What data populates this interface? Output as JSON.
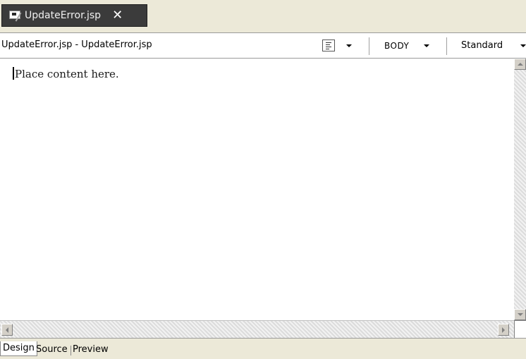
{
  "editor_tab": {
    "title": "UpdateError.jsp",
    "close_symbol": "✕"
  },
  "breadcrumb": {
    "file_path": "UpdateError.jsp - UpdateError.jsp",
    "tag": "BODY",
    "style": "Standard"
  },
  "canvas": {
    "placeholder": "Place content here."
  },
  "page_tabs": [
    {
      "label": "Design",
      "active": true
    },
    {
      "label": "Source",
      "active": false
    },
    {
      "label": "Preview",
      "active": false
    }
  ],
  "icons": {
    "tab_icon": "jsp-file-icon",
    "view_icon": "document-view-icon"
  },
  "colors": {
    "tab_bg": "#3b3b3b",
    "chrome_bg": "#ece9d8",
    "canvas_bg": "#ffffff"
  }
}
